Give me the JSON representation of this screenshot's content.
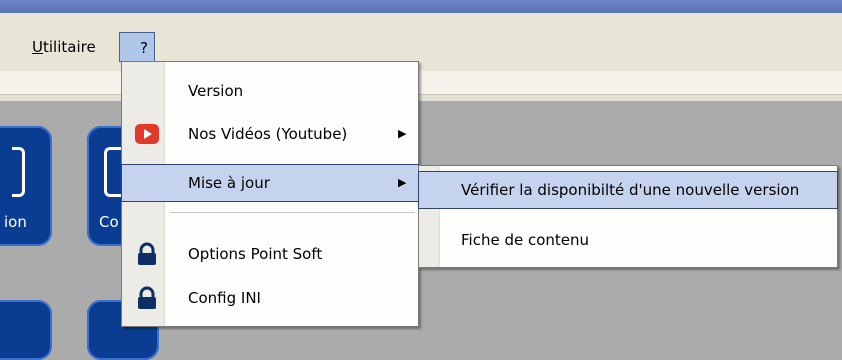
{
  "menubar": {
    "items": [
      {
        "label": "Utilitaire",
        "mnemonic": "U",
        "rest": "tilitaire"
      },
      {
        "label": "?"
      }
    ]
  },
  "workspace": {
    "tile_labels": [
      "ion",
      "Co"
    ]
  },
  "dropdown": {
    "items": [
      {
        "label": "Version",
        "icon": null,
        "has_submenu": false
      },
      {
        "label": "Nos Vidéos (Youtube)",
        "icon": "youtube-icon",
        "has_submenu": true
      },
      {
        "label": "Mise à jour",
        "icon": null,
        "has_submenu": true,
        "highlighted": true
      },
      {
        "label": "Options Point Soft",
        "icon": "lock-icon",
        "has_submenu": false
      },
      {
        "label": "Config INI",
        "icon": "lock-icon",
        "has_submenu": false
      }
    ],
    "submenu_arrow": "▶"
  },
  "submenu": {
    "items": [
      {
        "label": "Vérifier la disponibilté d'une nouvelle version",
        "highlighted": true
      },
      {
        "label": "Fiche de contenu",
        "highlighted": false
      }
    ]
  },
  "colors": {
    "title_bar": "#5f78bf",
    "menu_highlight": "#c6d3ee",
    "icon_tile": "#0a3c92",
    "youtube_red": "#e23a2a",
    "lock_blue": "#0d2f66"
  }
}
